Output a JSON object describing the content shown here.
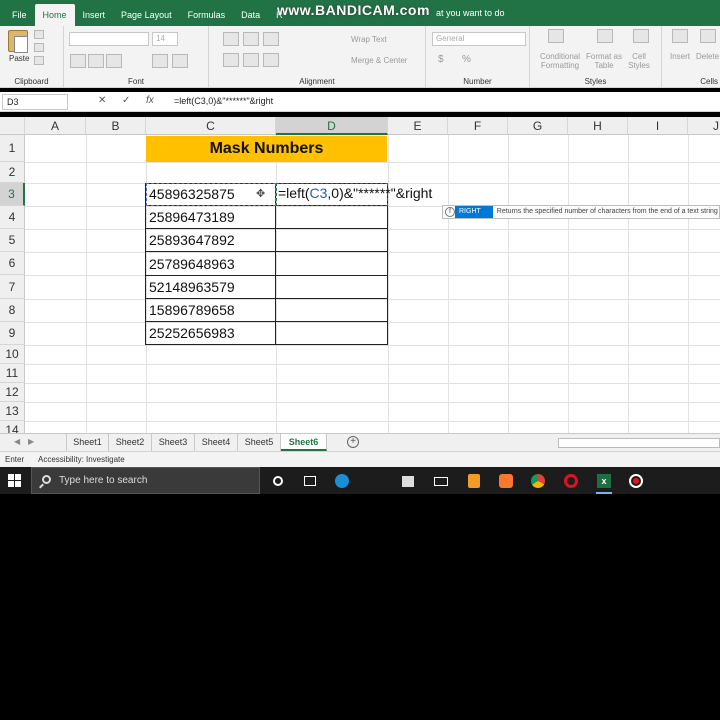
{
  "ribbon_tabs": [
    "File",
    "Home",
    "Insert",
    "Page Layout",
    "Formulas",
    "Data",
    "R"
  ],
  "watermark": "www.BANDICAM.com",
  "tell_me": "at you want to do",
  "clipboard": {
    "paste": "Paste",
    "label": "Clipboard"
  },
  "font": {
    "size": "14",
    "label": "Font"
  },
  "alignment": {
    "wrap": "Wrap Text",
    "merge": "Merge & Center",
    "label": "Alignment"
  },
  "number": {
    "format": "General",
    "label": "Number"
  },
  "styles": {
    "conditional": "Conditional Formatting",
    "format_table": "Format as Table",
    "cell_styles": "Cell Styles",
    "label": "Styles"
  },
  "cells": {
    "insert": "Insert",
    "delete": "Delete",
    "label": "Cells"
  },
  "formula_bar": {
    "name_box": "D3",
    "formula": "=left(C3,0)&\"******\"&right"
  },
  "columns": [
    "A",
    "B",
    "C",
    "D",
    "E",
    "F",
    "G",
    "H",
    "I",
    "J"
  ],
  "rows": [
    "1",
    "2",
    "3",
    "4",
    "5",
    "6",
    "7",
    "8",
    "9",
    "10",
    "11",
    "12",
    "13",
    "14"
  ],
  "title": "Mask Numbers",
  "numbers": [
    "45896325875",
    "25896473189",
    "25893647892",
    "25789648963",
    "52148963579",
    "15896789658",
    "25252656983"
  ],
  "editing": {
    "pre": "=left(",
    "ref": "C3",
    "post": ",0)&\"******\"&right"
  },
  "tooltip": {
    "fn": "RIGHT",
    "desc": "Returns the specified number of characters from the end of a text string"
  },
  "sheets": [
    "Sheet1",
    "Sheet2",
    "Sheet3",
    "Sheet4",
    "Sheet5",
    "Sheet6"
  ],
  "status": {
    "mode": "Enter",
    "accessibility": "Accessibility: Investigate"
  },
  "taskbar": {
    "search_placeholder": "Type here to search"
  }
}
